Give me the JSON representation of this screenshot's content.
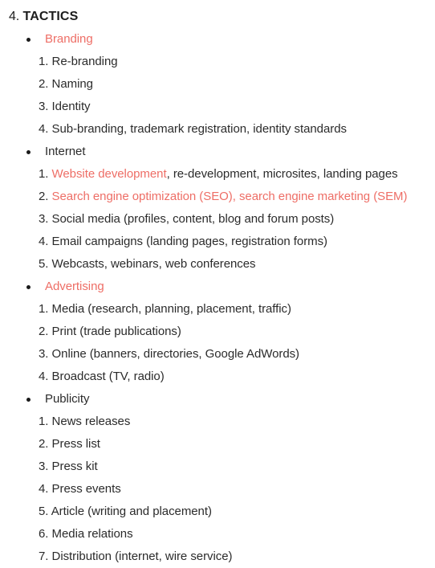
{
  "document": {
    "background_color": "#ffffff",
    "text_color": "#2b2b2b",
    "accent_color": "#ee6e66",
    "heading": {
      "number": "4.",
      "title": "TACTICS"
    },
    "sections": [
      {
        "bullet_label": "Branding",
        "bullet_accent": true,
        "items": [
          {
            "number": "1.",
            "lead": "Re-branding",
            "lead_accent": false,
            "tail": ""
          },
          {
            "number": "2.",
            "lead": "Naming",
            "lead_accent": false,
            "tail": ""
          },
          {
            "number": "3.",
            "lead": "Identity",
            "lead_accent": false,
            "tail": ""
          },
          {
            "number": "4.",
            "lead": "Sub-branding, trademark registration, identity standards",
            "lead_accent": false,
            "tail": ""
          }
        ]
      },
      {
        "bullet_label": "Internet",
        "bullet_accent": false,
        "items": [
          {
            "number": "1.",
            "lead": "Website development",
            "lead_accent": true,
            "tail": ", re-development, microsites, landing pages"
          },
          {
            "number": "2.",
            "lead": "Search engine optimization (SEO), search engine marketing (SEM)",
            "lead_accent": true,
            "tail": ""
          },
          {
            "number": "3.",
            "lead": "Social media (profiles, content, blog and forum posts)",
            "lead_accent": false,
            "tail": ""
          },
          {
            "number": "4.",
            "lead": "Email campaigns (landing pages, registration forms)",
            "lead_accent": false,
            "tail": ""
          },
          {
            "number": "5.",
            "lead": "Webcasts, webinars, web conferences",
            "lead_accent": false,
            "tail": ""
          }
        ]
      },
      {
        "bullet_label": "Advertising",
        "bullet_accent": true,
        "items": [
          {
            "number": "1.",
            "lead": "Media (research, planning, placement, traffic)",
            "lead_accent": false,
            "tail": ""
          },
          {
            "number": "2.",
            "lead": "Print (trade publications)",
            "lead_accent": false,
            "tail": ""
          },
          {
            "number": "3.",
            "lead": "Online (banners, directories, Google AdWords)",
            "lead_accent": false,
            "tail": ""
          },
          {
            "number": "4.",
            "lead": "Broadcast (TV, radio)",
            "lead_accent": false,
            "tail": ""
          }
        ]
      },
      {
        "bullet_label": "Publicity",
        "bullet_accent": false,
        "items": [
          {
            "number": "1.",
            "lead": "News releases",
            "lead_accent": false,
            "tail": ""
          },
          {
            "number": "2.",
            "lead": "Press list",
            "lead_accent": false,
            "tail": ""
          },
          {
            "number": "3.",
            "lead": "Press kit",
            "lead_accent": false,
            "tail": ""
          },
          {
            "number": "4.",
            "lead": "Press events",
            "lead_accent": false,
            "tail": ""
          },
          {
            "number": "5.",
            "lead": "Article (writing and placement)",
            "lead_accent": false,
            "tail": ""
          },
          {
            "number": "6.",
            "lead": "Media relations",
            "lead_accent": false,
            "tail": ""
          },
          {
            "number": "7.",
            "lead": "Distribution (internet, wire service)",
            "lead_accent": false,
            "tail": ""
          }
        ]
      }
    ]
  }
}
